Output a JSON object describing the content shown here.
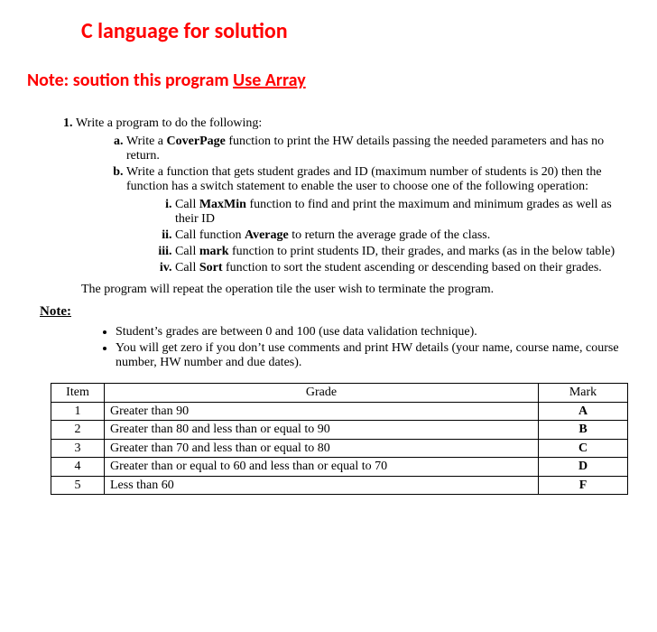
{
  "header": {
    "title": "C language for solution",
    "note_prefix": "Note:  soution this program ",
    "note_underlined": "Use Array"
  },
  "question": {
    "lead": "Write a program to do the following:",
    "a_pre": "Write a ",
    "a_bold": "CoverPage",
    "a_post": " function to print the HW details passing the needed parameters and has no return.",
    "b_text": "Write a function that gets student grades and ID (maximum number of students is 20) then the function has a switch statement to enable the user to choose one of the following operation:",
    "i_pre": "Call ",
    "i_bold": "MaxMin",
    "i_post": " function to find and print the maximum and minimum grades as well as their ID",
    "ii_pre": "Call function ",
    "ii_bold": "Average",
    "ii_post": " to return the average grade of the class.",
    "iii_pre": "Call ",
    "iii_bold": "mark",
    "iii_post": " function to print students ID, their grades, and marks (as in the below table)",
    "iv_pre": "Call ",
    "iv_bold": "Sort",
    "iv_post": " function to sort the student ascending or descending based on their grades.",
    "tail": "The program will repeat the operation tile the user wish to terminate the program."
  },
  "notes": {
    "label": " Note:",
    "bullets": [
      "Student’s grades are between 0 and 100 (use data validation technique).",
      "You will get zero if you don’t use comments and print HW details (your name, course name, course number, HW number and due dates)."
    ]
  },
  "table": {
    "headers": {
      "item": "Item",
      "grade": "Grade",
      "mark": "Mark"
    },
    "rows": [
      {
        "item": "1",
        "grade": "Greater than 90",
        "mark": "A"
      },
      {
        "item": "2",
        "grade": "Greater than 80 and less than or equal to 90",
        "mark": "B"
      },
      {
        "item": "3",
        "grade": "Greater than 70 and less than or equal to 80",
        "mark": "C"
      },
      {
        "item": "4",
        "grade": "Greater than or equal to 60 and less than or equal to 70",
        "mark": "D"
      },
      {
        "item": "5",
        "grade": "Less than 60",
        "mark": "F"
      }
    ]
  }
}
